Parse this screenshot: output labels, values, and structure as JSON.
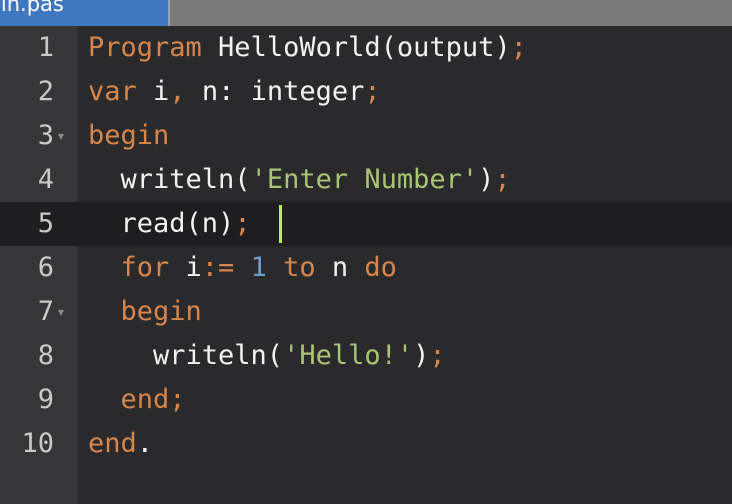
{
  "tab": {
    "title": "main.pas",
    "visible_label": "ain.pas"
  },
  "lines": [
    {
      "num": "1",
      "tokens": [
        {
          "t": "kw",
          "v": "Program"
        },
        {
          "t": "id",
          "v": " HelloWorld(output)"
        },
        {
          "t": "semi",
          "v": ";"
        }
      ]
    },
    {
      "num": "2",
      "tokens": [
        {
          "t": "kw",
          "v": "var"
        },
        {
          "t": "id",
          "v": " i"
        },
        {
          "t": "semi",
          "v": ","
        },
        {
          "t": "id",
          "v": " n: integer"
        },
        {
          "t": "semi",
          "v": ";"
        }
      ]
    },
    {
      "num": "3",
      "fold": "▾",
      "tokens": [
        {
          "t": "kw",
          "v": "begin"
        }
      ]
    },
    {
      "num": "4",
      "tokens": [
        {
          "t": "id",
          "v": "  writeln("
        },
        {
          "t": "str",
          "v": "'Enter Number'"
        },
        {
          "t": "id",
          "v": ")"
        },
        {
          "t": "semi",
          "v": ";"
        }
      ]
    },
    {
      "num": "5",
      "tokens": [
        {
          "t": "id",
          "v": "  read(n)"
        },
        {
          "t": "semi",
          "v": ";"
        }
      ]
    },
    {
      "num": "6",
      "tokens": [
        {
          "t": "kw",
          "v": "  for"
        },
        {
          "t": "id",
          "v": " i"
        },
        {
          "t": "semi",
          "v": ":="
        },
        {
          "t": "num",
          "v": " 1"
        },
        {
          "t": "kw",
          "v": " to"
        },
        {
          "t": "id",
          "v": " n"
        },
        {
          "t": "kw",
          "v": " do"
        }
      ]
    },
    {
      "num": "7",
      "fold": "▾",
      "tokens": [
        {
          "t": "kw",
          "v": "  begin"
        }
      ]
    },
    {
      "num": "8",
      "tokens": [
        {
          "t": "id",
          "v": "    writeln("
        },
        {
          "t": "str",
          "v": "'Hello!'"
        },
        {
          "t": "id",
          "v": ")"
        },
        {
          "t": "semi",
          "v": ";"
        }
      ]
    },
    {
      "num": "9",
      "tokens": [
        {
          "t": "kw",
          "v": "  end"
        },
        {
          "t": "semi",
          "v": ";"
        }
      ]
    },
    {
      "num": "10",
      "tokens": [
        {
          "t": "kw",
          "v": "end"
        },
        {
          "t": "id",
          "v": "."
        }
      ]
    }
  ],
  "active_line_number": "5",
  "colors": {
    "keyword": "#d6864c",
    "string": "#a9c473",
    "number": "#6f9fd1",
    "identifier": "#f2f2f2",
    "cursor": "#b9f24a",
    "tab_active": "#3f78bf"
  }
}
